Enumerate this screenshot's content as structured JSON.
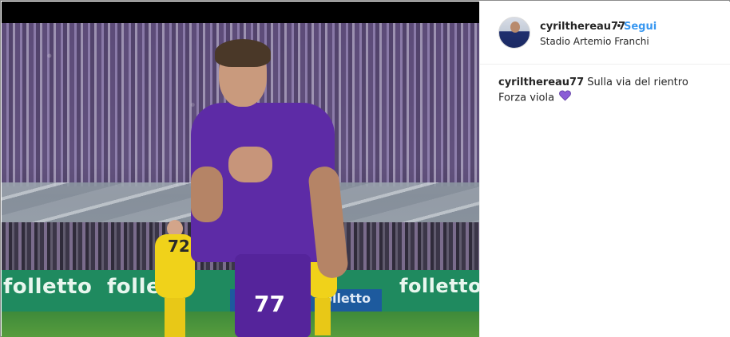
{
  "post": {
    "username": "cyrilthereau77",
    "separator": "•",
    "follow_label": "Segui",
    "location": "Stadio Artemio Franchi",
    "caption": {
      "username": "cyrilthereau77",
      "line1": "Sulla via del rientro",
      "line2": "Forza viola",
      "emoji_icon": "purple-heart-icon"
    }
  },
  "photo": {
    "shorts_number": "77",
    "opponent_number": "72",
    "boards": [
      "folletto",
      "folletto",
      "folletto",
      "folletto"
    ],
    "blue_board": "folletto"
  },
  "colors": {
    "follow_blue": "#3897f0",
    "fiorentina_purple": "#5d2ba6",
    "heart_purple": "#8a5cd6",
    "board_green": "#1f8a5f"
  }
}
